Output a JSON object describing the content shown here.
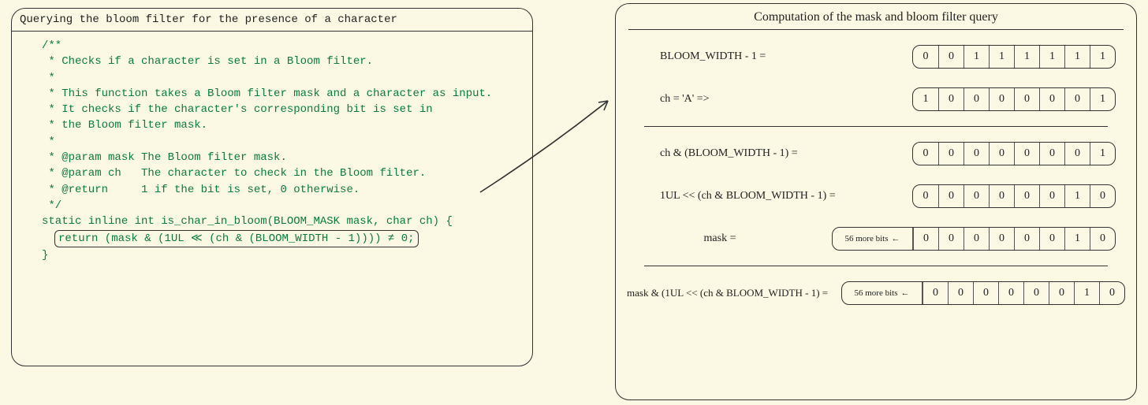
{
  "left": {
    "title": "Querying the bloom filter for the presence of a character",
    "code": {
      "l1": "/**",
      "l2": " * Checks if a character is set in a Bloom filter.",
      "l3": " *",
      "l4": " * This function takes a Bloom filter mask and a character as input.",
      "l5": " * It checks if the character's corresponding bit is set in",
      "l6": " * the Bloom filter mask.",
      "l7": " *",
      "l8": " * @param mask The Bloom filter mask.",
      "l9": " * @param ch   The character to check in the Bloom filter.",
      "l10": " * @return     1 if the bit is set, 0 otherwise.",
      "l11": " */",
      "l12": "static inline int is_char_in_bloom(BLOOM_MASK mask, char ch) {",
      "l13": "return (mask & (1UL ≪ (ch & (BLOOM_WIDTH - 1)))) ≠ 0;",
      "l14": "}"
    }
  },
  "right": {
    "title": "Computation of the mask and bloom filter query",
    "rows": {
      "r1": {
        "label": "BLOOM_WIDTH - 1 =",
        "bits": [
          "0",
          "0",
          "1",
          "1",
          "1",
          "1",
          "1",
          "1"
        ]
      },
      "r2": {
        "label": "ch = 'A' =>",
        "bits": [
          "1",
          "0",
          "0",
          "0",
          "0",
          "0",
          "0",
          "1"
        ]
      },
      "r3": {
        "label": "ch & (BLOOM_WIDTH - 1) =",
        "bits": [
          "0",
          "0",
          "0",
          "0",
          "0",
          "0",
          "0",
          "1"
        ]
      },
      "r4": {
        "label": "1UL << (ch & BLOOM_WIDTH - 1) =",
        "bits": [
          "0",
          "0",
          "0",
          "0",
          "0",
          "0",
          "1",
          "0"
        ]
      },
      "r5": {
        "label": "mask =",
        "more": "56 more bits",
        "bits": [
          "0",
          "0",
          "0",
          "0",
          "0",
          "0",
          "1",
          "0"
        ]
      },
      "r6": {
        "label": "mask & (1UL << (ch & BLOOM_WIDTH - 1) =",
        "more": "56 more bits",
        "bits": [
          "0",
          "0",
          "0",
          "0",
          "0",
          "0",
          "1",
          "0"
        ]
      }
    }
  }
}
